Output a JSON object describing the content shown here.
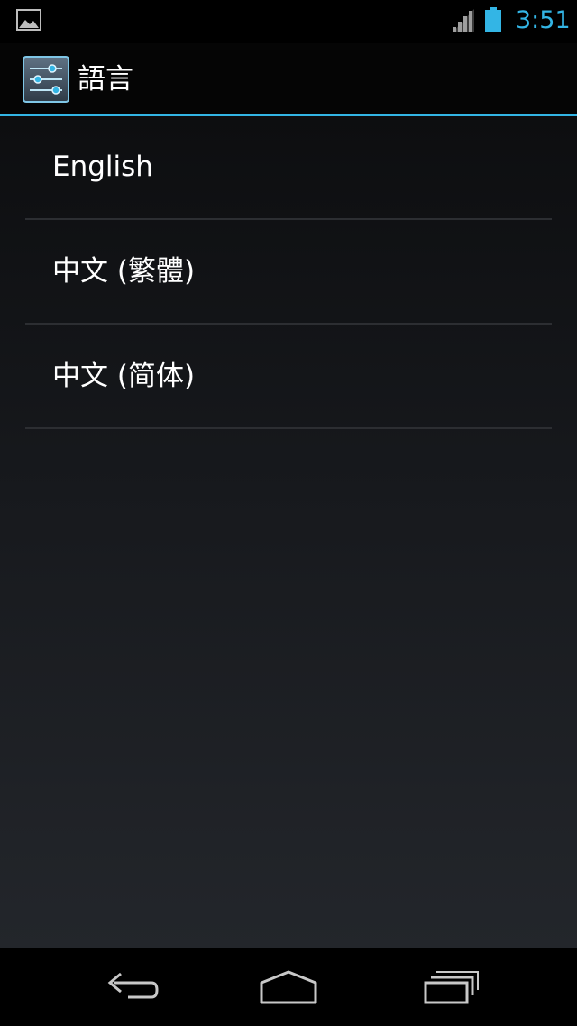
{
  "status_bar": {
    "time": "3:51",
    "accent_color": "#33b5e5",
    "icons": [
      "picture-notification-icon",
      "signal-icon",
      "battery-icon"
    ]
  },
  "action_bar": {
    "title": "語言",
    "icon": "settings-sliders-icon"
  },
  "languages": [
    {
      "label": "English"
    },
    {
      "label": "中文 (繁體)"
    },
    {
      "label": "中文 (简体)"
    }
  ],
  "nav_bar": {
    "buttons": [
      "back-icon",
      "home-icon",
      "recent-apps-icon"
    ]
  }
}
